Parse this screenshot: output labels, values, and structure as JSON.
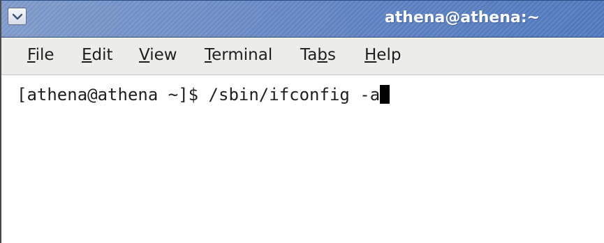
{
  "window": {
    "title": "athena@athena:~",
    "menu_button_icon": "chevron-down-icon"
  },
  "menubar": {
    "items": [
      {
        "label": "File",
        "pre": "",
        "mnemonic": "F",
        "post": "ile"
      },
      {
        "label": "Edit",
        "pre": "",
        "mnemonic": "E",
        "post": "dit"
      },
      {
        "label": "View",
        "pre": "",
        "mnemonic": "V",
        "post": "iew"
      },
      {
        "label": "Terminal",
        "pre": "",
        "mnemonic": "T",
        "post": "erminal"
      },
      {
        "label": "Tabs",
        "pre": "Ta",
        "mnemonic": "b",
        "post": "s"
      },
      {
        "label": "Help",
        "pre": "",
        "mnemonic": "H",
        "post": "elp"
      }
    ]
  },
  "terminal": {
    "prompt": "[athena@athena ~]$ ",
    "command": "/sbin/ifconfig -a"
  }
}
